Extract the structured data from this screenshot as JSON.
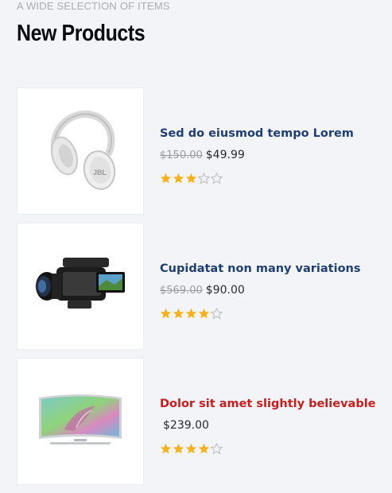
{
  "section": {
    "kicker": "A WIDE SELECTION OF ITEMS",
    "title": "New Products"
  },
  "colors": {
    "star_filled": "#f7b21a",
    "star_empty": "#b9bcc2"
  },
  "products": [
    {
      "image": "headphones-image",
      "name": "Sed do eiusmod tempo Lorem",
      "old_price": "$150.00",
      "price": "$49.99",
      "rating": 3,
      "rating_max": 5
    },
    {
      "image": "camcorder-image",
      "name": "Cupidatat non many variations",
      "old_price": "$569.00",
      "price": "$90.00",
      "rating": 4,
      "rating_max": 5
    },
    {
      "image": "curved-tv-image",
      "name": "Dolor sit amet slightly believable",
      "old_price": "",
      "price": "$239.00",
      "rating": 4,
      "rating_max": 5
    }
  ]
}
